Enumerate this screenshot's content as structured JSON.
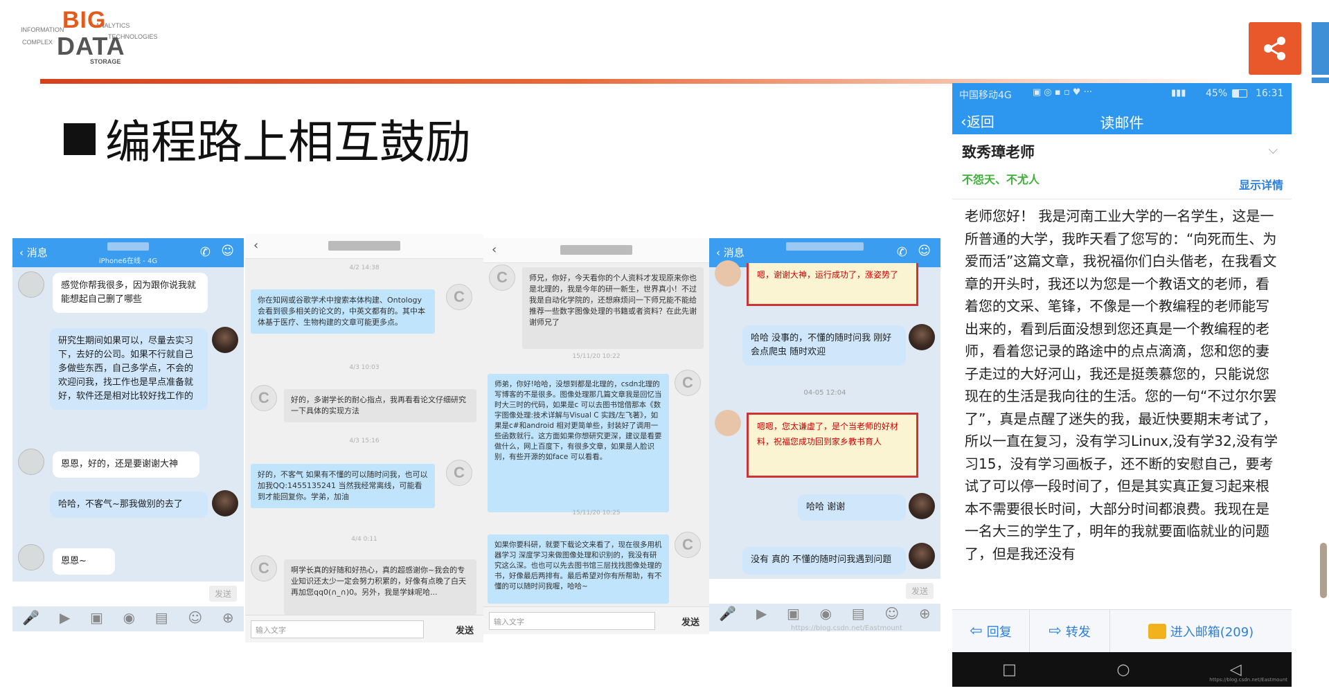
{
  "logo": {
    "big": "BIG",
    "data": "DATA",
    "words": [
      "STORAGE",
      "TECHNOLOGIES",
      "INFORMATION",
      "COMPLEX",
      "ANALYTICS"
    ]
  },
  "title": "编程路上相互鼓励",
  "colors": {
    "accent": "#e8582a",
    "rule": "#d6401c",
    "qq_blue": "#3a9df0",
    "phone_blue": "#2d96ef"
  },
  "shot1": {
    "back": "消息",
    "subtitle": "iPhone6在线 - 4G",
    "messages": [
      "感觉你帮我很多，因为跟你说我就能想起自己删了哪些",
      "研究生期间如果可以，尽量去实习下，去好的公司。如果不行就自己多做些东西，自己多学点，不会的欢迎问我，找工作也是早点准备就好，软件还是相对比较好找工作的",
      "恩恩，好的，还是要谢谢大神",
      "哈哈，不客气~那我做别的去了",
      "恩恩~"
    ],
    "send": "发送"
  },
  "shot2": {
    "times": [
      "4/2 14:38",
      "4/3 10:03",
      "4/3 15:16",
      "4/4 0:11"
    ],
    "messages": [
      "你在知网或谷歌学术中搜索本体构建、Ontology 会看到很多相关的论文的，中英文都有的。其中本体基于医疗、生物构建的文章可能更多点。",
      "好的，多谢学长的耐心指点，我再看看论文仔细研究一下具体的实现方法",
      "好的，不客气 如果有不懂的可以随时问我，也可以加我QQ:1455135241 当然我经常离线，可能看到才能回复你。学弟，加油",
      "啊学长真的好随和好热心，真的超感谢你~我会的专业知识还太少一定会努力积累的，好像有点晚了白天再加您qq0(∩_∩)0。另外，我是学妹呢哈..."
    ],
    "input": "输入文字",
    "send": "发送"
  },
  "shot3": {
    "times": [
      "15/11/20 10:22",
      "15/11/20 10:25"
    ],
    "messages": [
      "师兄，你好，今天看你的个人资料才发现原来你也是北理的，我是今年的研一新生，世界真小！不过我是自动化学院的，还想麻烦问一下师兄能不能给推荐一些数字图像处理的书籍或者资料？在此先谢谢师兄了",
      "师弟，你好!哈哈，没想到都是北理的，csdn北理的写博客的不是很多。图像处理那几篇文章我是回忆当时大三时的代码，如果是c 可以去图书馆借那本《数字图像处理:技术详解与Visual C 实践/左飞著》，如果是c#和android 相对更简单些，封装好了调用一些函数就行。这方面如果你想研究更深，建议是看要做什么，网上百度下，有很多文章，如果是人脸识别，有些开源的如face 可以看看。",
      "如果你要科研，就要下载论文来看了，现在很多用机器学习 深度学习来做图像处理和识别的，我没有研究这么深。也也可以先去图书馆三层找找图像处理的书，好像最后两排有。最后希望对你有所帮助，有不懂的可以随时问我喔，哈哈~"
    ],
    "input": "输入文字",
    "send": "发送"
  },
  "shot4": {
    "back": "消息",
    "time": "04-05 12:04",
    "messages": [
      "嗯，谢谢大神，运行成功了，涨姿势了",
      "哈哈 没事的，不懂的随时问我 刚好会点爬虫 随时欢迎",
      "嗯嗯，您太谦虚了，是个当老师的好材料，祝福您成功回到家乡教书育人",
      "哈哈 谢谢",
      "没有 真的 不懂的随时问我遇到问题"
    ],
    "send": "发送",
    "watermark": "https://blog.csdn.net/Eastmount"
  },
  "phone": {
    "status_left": "中国移动4G",
    "status_right": "45%",
    "time": "16:31",
    "back": "返回",
    "nav_title": "读邮件",
    "subject": "致秀璋老师",
    "tags": "不怨天、不尤人",
    "details": "显示详情",
    "body": "老师您好！ 我是河南工业大学的一名学生，这是一所普通的大学，我昨天看了您写的：“向死而生、为爱而活”这篇文章，我祝福你们白头偕老，在我看文章的开头时，我还以为您是一个教语文的老师，看着您的文采、笔锋，不像是一个教编程的老师能写出来的，看到后面没想到您还真是一个教编程的老师，看着您记录的路途中的点点滴滴，您和您的妻子走过的大好河山，我还是挺羡慕您的，只能说您现在的生活是我向往的生活。您的一句“不过尔尔罢了”，真是点醒了迷失的我，最近快要期末考试了，所以一直在复习，没有学习Linux,没有学32,没有学习15，没有学习画板子，还不断的安慰自己，要考试了可以停一段时间了，但是其实真正复习起来根本不需要很长时间，大部分时间都浪费。我现在是一名大三的学生了，明年的我就要面临就业的问题了，但是我还没有",
    "reply": "回复",
    "forward": "转发",
    "inbox": "进入邮箱(209)",
    "watermark": "https://blog.csdn.net/Eastmount"
  }
}
